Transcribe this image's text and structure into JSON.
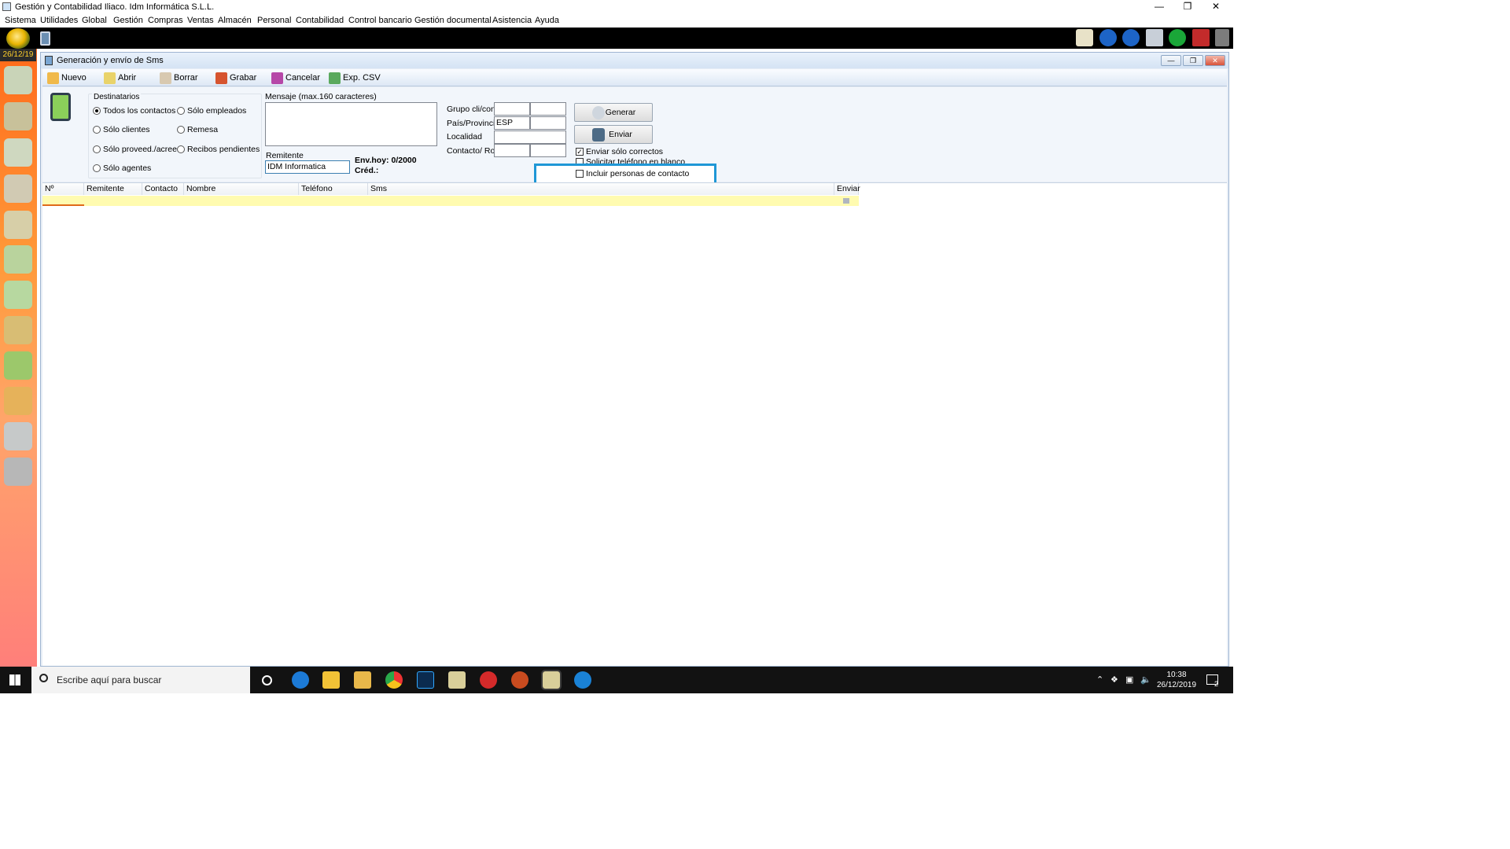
{
  "window": {
    "title": "Gestión y Contabilidad Iliaco. Idm Informática S.L.L."
  },
  "menu": [
    "Sistema",
    "Utilidades",
    "Global",
    "Gestión",
    "Compras",
    "Ventas",
    "Almacén",
    "Personal",
    "Contabilidad",
    "Control bancario",
    "Gestión documental",
    "Asistencia",
    "Ayuda"
  ],
  "date_badge": "26/12/19",
  "child": {
    "title": "Generación y envío de Sms",
    "toolbar": {
      "nuevo": "Nuevo",
      "abrir": "Abrir",
      "borrar": "Borrar",
      "grabar": "Grabar",
      "cancelar": "Cancelar",
      "exp_csv": "Exp. CSV"
    }
  },
  "destinatarios": {
    "legend": "Destinatarios",
    "options": {
      "todos": "Todos los contactos",
      "empleados": "Sólo empleados",
      "clientes": "Sólo clientes",
      "remesa": "Remesa",
      "proveed": "Sólo proveed./acreed.",
      "recibos": "Recibos pendientes",
      "agentes": "Sólo agentes"
    },
    "selected": "Todos los contactos"
  },
  "mensaje": {
    "label": "Mensaje (max.160 caracteres)",
    "value": ""
  },
  "remitente": {
    "label": "Remitente",
    "value": "IDM Informatica"
  },
  "env_hoy": "Env.hoy: 0/2000",
  "cred": "Créd.:",
  "filters": {
    "grupo_label": "Grupo cli/con",
    "pais_label": "País/Provincia",
    "pais_value": "ESP",
    "localidad_label": "Localidad",
    "contacto_label": "Contacto/ Rol"
  },
  "buttons": {
    "generar": "Generar",
    "enviar": "Enviar"
  },
  "checks": {
    "enviar_correctos": "Enviar sólo correctos",
    "solicitar_telefono": "Solicitar teléfono en blanco",
    "incluir_personas": "Incluir personas de contacto"
  },
  "grid": {
    "columns": [
      "Nº",
      "Remitente",
      "Contacto",
      "Nombre",
      "Teléfono",
      "Sms",
      "Enviar"
    ]
  },
  "taskbar": {
    "search_placeholder": "Escribe aquí para buscar",
    "time": "10:38",
    "date": "26/12/2019",
    "notifications": "2"
  },
  "colors": {
    "accent_highlight": "#1f97d6",
    "row_yellow": "#fffbb0",
    "left_bar": "#ff8a3a"
  }
}
